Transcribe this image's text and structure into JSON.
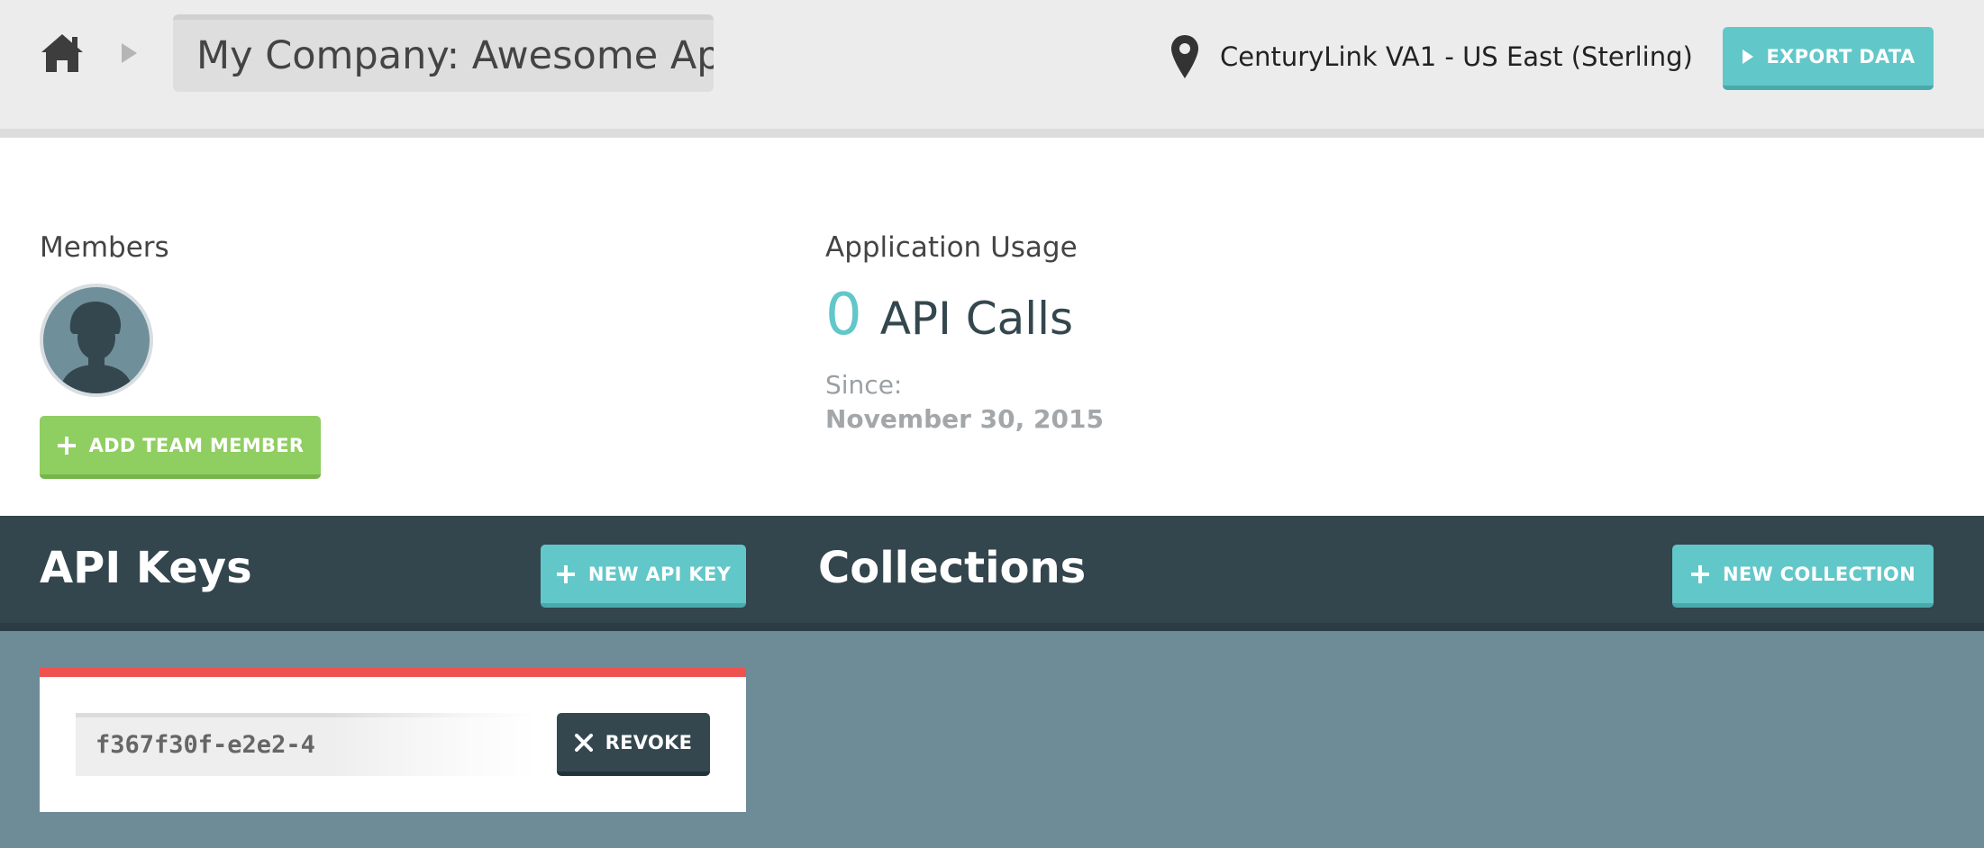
{
  "header": {
    "app_name": "My Company: Awesome App",
    "location": "CenturyLink VA1 - US East (Sterling)",
    "export_label": "EXPORT DATA"
  },
  "members": {
    "title": "Members",
    "add_label": "ADD TEAM MEMBER"
  },
  "usage": {
    "title": "Application Usage",
    "count": "0",
    "unit": "API Calls",
    "since_label": "Since:",
    "since_date": "November 30, 2015"
  },
  "api_keys": {
    "title": "API Keys",
    "new_label": "NEW API KEY",
    "keys": [
      {
        "value": "f367f30f-e2e2-4",
        "revoke_label": "REVOKE"
      }
    ]
  },
  "collections": {
    "title": "Collections",
    "new_label": "NEW COLLECTION"
  },
  "colors": {
    "accent": "#62c7c9",
    "success": "#8fce61",
    "danger": "#ef5350",
    "dark": "#33454d",
    "canvas": "#6e8c98"
  },
  "icons": [
    "home-icon",
    "breadcrumb-arrow-icon",
    "location-pin-icon",
    "play-icon",
    "plus-icon",
    "close-icon",
    "avatar-silhouette-icon"
  ]
}
